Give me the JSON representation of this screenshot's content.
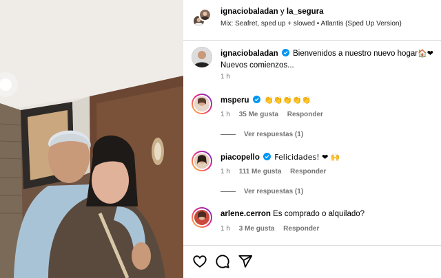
{
  "header": {
    "user1": "ignaciobaladan",
    "connector": "y",
    "user2": "la_segura",
    "audio": "Mix: Seafret, sped up + slowed • Atlantis (Sped Up Version)"
  },
  "caption": {
    "username": "ignaciobaladan",
    "text_line1": "Bienvenidos a nuestro nuevo hogar",
    "emojis": "🏠❤",
    "text_line2": "Nuevos comienzos...",
    "time": "1 h"
  },
  "comments": [
    {
      "username": "msperu",
      "text": "👏👏👏👏👏",
      "time": "1 h",
      "likes": "35 Me gusta",
      "reply": "Responder",
      "view_replies": "Ver respuestas (1)"
    },
    {
      "username": "piacopello",
      "text": "Felicidades! ❤ 🙌",
      "time": "1 h",
      "likes": "111 Me gusta",
      "reply": "Responder",
      "view_replies": "Ver respuestas (1)"
    },
    {
      "username": "arlene.cerron",
      "text": "Es comprado o alquilado?",
      "time": "1 h",
      "likes": "3 Me gusta",
      "reply": "Responder"
    }
  ],
  "icons": [
    "heart-icon",
    "comment-icon",
    "share-icon",
    "verified-badge-icon"
  ],
  "colors": {
    "verified": "#0095f6",
    "muted": "#737373",
    "divider": "#dbdbdb",
    "story_ring": "#ee2a7b"
  }
}
